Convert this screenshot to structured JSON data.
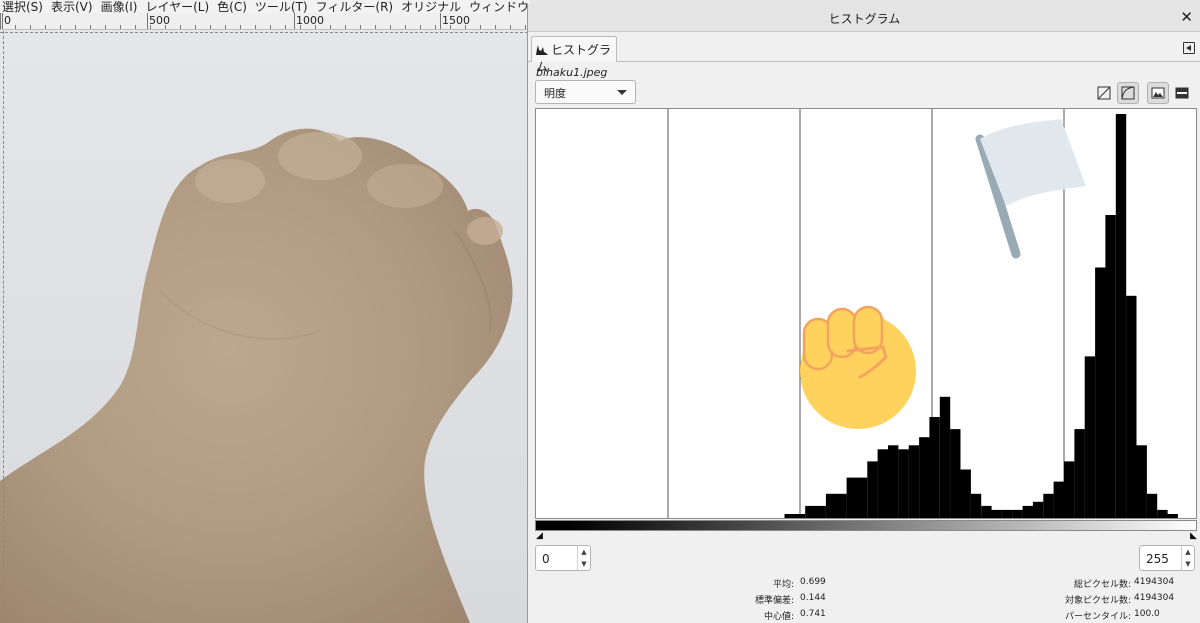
{
  "menubar": {
    "items": [
      "選択(S)",
      "表示(V)",
      "画像(I)",
      "レイヤー(L)",
      "色(C)",
      "ツール(T)",
      "フィルター(R)",
      "オリジナル",
      "ウィンドウ(W)"
    ]
  },
  "ruler": {
    "labels": [
      "0",
      "500",
      "1000",
      "1500"
    ]
  },
  "dialog": {
    "title": "ヒストグラム",
    "tab_label": "ヒストグラム",
    "filename": "bihaku1.jpeg",
    "channel": "明度",
    "range_start": "0",
    "range_end": "255"
  },
  "stats": {
    "mean_label": "平均:",
    "mean_value": "0.699",
    "stddev_label": "標準偏差:",
    "stddev_value": "0.144",
    "median_label": "中心値:",
    "median_value": "0.741",
    "pixels_label": "総ピクセル数:",
    "pixels_value": "4194304",
    "count_label": "対象ピクセル数:",
    "count_value": "4194304",
    "percentile_label": "パーセンタイル:",
    "percentile_value": "100.0"
  },
  "icons": [
    "histogram-tab-icon",
    "tab-menu-icon",
    "close-icon",
    "linear-scale-icon",
    "log-scale-icon",
    "view-image-icon",
    "view-dark-icon",
    "raised-fist-emoji",
    "white-flag-emoji"
  ],
  "colors": {
    "histogram_bars": "#000000",
    "fist": "#FFD25E",
    "flag": "#E1E8ED",
    "flag_pole": "#99AAB5"
  },
  "chart_data": {
    "type": "bar",
    "title": "",
    "xlabel": "",
    "ylabel": "",
    "xlim": [
      0,
      255
    ],
    "x": [
      0,
      64,
      96,
      104,
      112,
      120,
      128,
      132,
      136,
      140,
      144,
      148,
      152,
      156,
      160,
      164,
      168,
      172,
      176,
      180,
      184,
      188,
      192,
      196,
      200,
      204,
      208,
      212,
      216,
      220,
      224,
      228,
      232,
      236,
      240,
      244,
      248,
      252
    ],
    "values": [
      0,
      0,
      1,
      3,
      6,
      10,
      14,
      17,
      18,
      17,
      18,
      20,
      25,
      30,
      22,
      12,
      6,
      3,
      2,
      2,
      2,
      3,
      4,
      6,
      9,
      14,
      22,
      40,
      62,
      75,
      100,
      55,
      18,
      6,
      2,
      1,
      0,
      0
    ],
    "grid": true,
    "legend": "none"
  }
}
